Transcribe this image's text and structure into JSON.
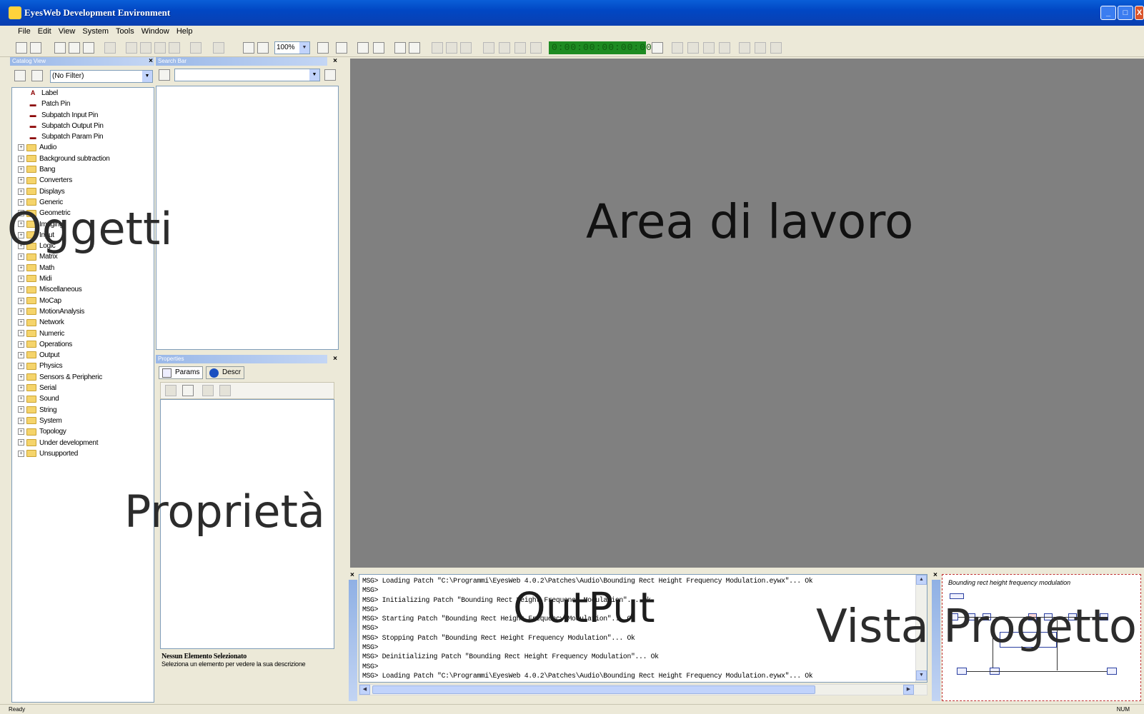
{
  "window": {
    "title": "EyesWeb Development Environment",
    "min_label": "_",
    "max_label": "□",
    "close_label": "X"
  },
  "menu": [
    "File",
    "Edit",
    "View",
    "System",
    "Tools",
    "Window",
    "Help"
  ],
  "toolbar": {
    "zoom": "100%",
    "timer": "0:00:00:00:00:00"
  },
  "catalog": {
    "caption": "Catalog View",
    "filter": "(No Filter)",
    "special_items": [
      {
        "label": "Label",
        "icon": "label-icon"
      },
      {
        "label": "Patch Pin",
        "icon": "patch-pin-icon"
      },
      {
        "label": "Subpatch Input Pin",
        "icon": "subpatch-input-pin-icon"
      },
      {
        "label": "Subpatch Output Pin",
        "icon": "subpatch-output-pin-icon"
      },
      {
        "label": "Subpatch Param Pin",
        "icon": "subpatch-param-pin-icon"
      }
    ],
    "folders": [
      "Audio",
      "Background subtraction",
      "Bang",
      "Converters",
      "Displays",
      "Generic",
      "Geometric",
      "Imaging",
      "Input",
      "Logic",
      "Matrix",
      "Math",
      "Midi",
      "Miscellaneous",
      "MoCap",
      "MotionAnalysis",
      "Network",
      "Numeric",
      "Operations",
      "Output",
      "Physics",
      "Sensors & Peripheric",
      "Serial",
      "Sound",
      "String",
      "System",
      "Topology",
      "Under development",
      "Unsupported"
    ]
  },
  "search": {
    "caption": "Search Bar"
  },
  "properties": {
    "caption": "Properties",
    "tab_params": "Params",
    "tab_descr": "Descr",
    "desc_title": "Nessun Elemento Selezionato",
    "desc_text": "Seleziona un elemento per vedere la sua descrizione"
  },
  "output": {
    "lines": [
      "MSG> Loading Patch \"C:\\Programmi\\EyesWeb 4.0.2\\Patches\\Audio\\Bounding Rect Height Frequency Modulation.eywx\"... Ok",
      "MSG>",
      "MSG> Initializing Patch \"Bounding Rect Height Frequency Modulation\"... Ok",
      "MSG>",
      "MSG> Starting Patch \"Bounding Rect Height Frequency Modulation\"... Ok",
      "MSG>",
      "MSG> Stopping Patch \"Bounding Rect Height Frequency Modulation\"... Ok",
      "MSG>",
      "MSG> Deinitializing Patch \"Bounding Rect Height Frequency Modulation\"... Ok",
      "MSG>",
      "MSG> Loading Patch \"C:\\Programmi\\EyesWeb 4.0.2\\Patches\\Audio\\Bounding Rect Height Frequency Modulation.eywx\"... Ok"
    ]
  },
  "project_view": {
    "title": "Bounding rect height frequency modulation"
  },
  "status": {
    "left": "Ready",
    "right": "NUM"
  },
  "overlay_labels": {
    "objects": "Oggetti",
    "workspace": "Area di lavoro",
    "properties": "Proprietà",
    "output": "OutPut",
    "project_view": "Vista Progetto"
  },
  "colors": {
    "titlebar": "#0147c4",
    "workspace": "#808080",
    "chrome": "#ece9d8",
    "timer": "#1e8b22"
  }
}
